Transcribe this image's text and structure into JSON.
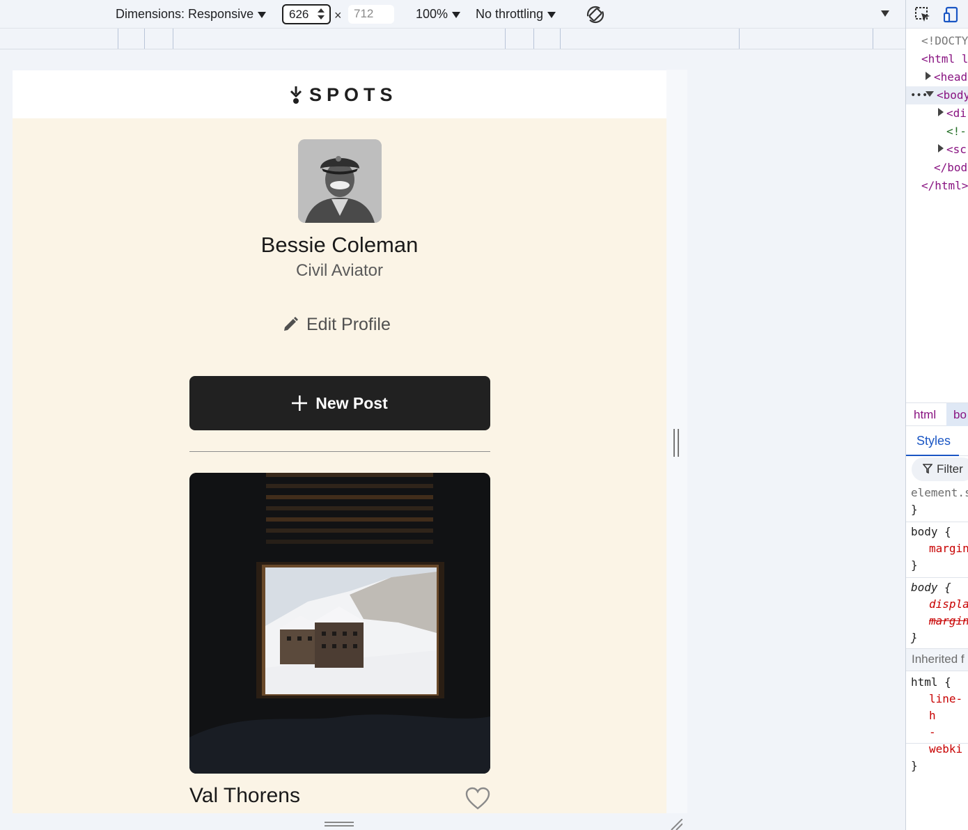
{
  "toolbar": {
    "dimensions_label": "Dimensions: Responsive",
    "width_value": "626",
    "times": "×",
    "height_placeholder": "712",
    "zoom": "100%",
    "throttling": "No throttling"
  },
  "site": {
    "logo_text": "SPOTS",
    "profile": {
      "name": "Bessie Coleman",
      "title": "Civil Aviator"
    },
    "edit_profile_label": "Edit Profile",
    "new_post_label": "New Post",
    "cards": [
      {
        "title": "Val Thorens"
      }
    ]
  },
  "devtools": {
    "dom": {
      "doctype": "<!DOCTY",
      "html_open": "<html l",
      "head": "<head",
      "body": "<body",
      "div": "<di",
      "comment": "<!--",
      "script": "<sc",
      "body_close": "</bod",
      "html_close": "</html>"
    },
    "breadcrumbs": [
      "html",
      "bo"
    ],
    "styles_tab": "Styles",
    "filter_placeholder": "Filter",
    "rules": {
      "element_selector": "element.s",
      "close": "}",
      "body_selector": "body {",
      "body_margin": "margin",
      "body2_selector": "body {",
      "body2_display": "displa",
      "body2_margin": "margin",
      "inherited": "Inherited f",
      "html_selector": "html {",
      "html_lineheight": "line-h",
      "html_webkit": "-webki"
    }
  }
}
